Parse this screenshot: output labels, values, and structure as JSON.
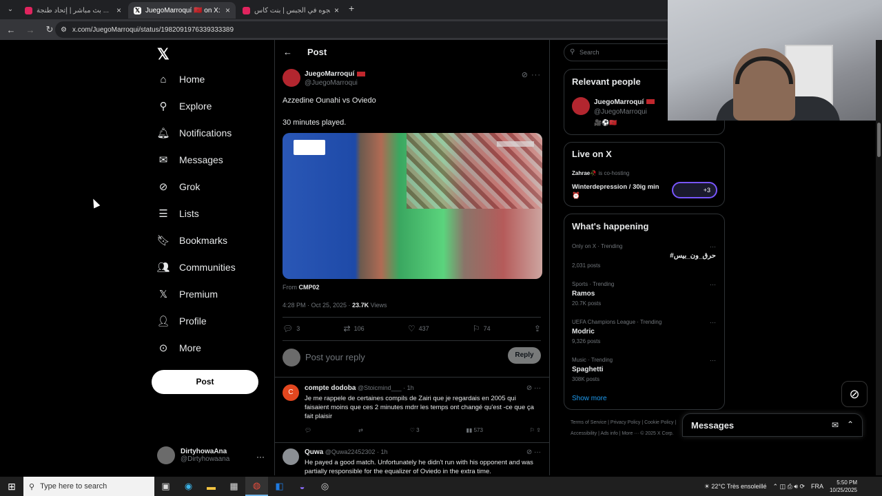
{
  "browser": {
    "tabs": [
      {
        "title": "بث مباشر | إتحاد طنجة ...",
        "active": false
      },
      {
        "title": "JuegoMarroquí 🇲🇦 on X: \"A...",
        "active": true
      },
      {
        "title": "ديدي ديجوه في الجبس | بنت كاس...",
        "active": false
      }
    ],
    "new_tab": "+",
    "url": "x.com/JuegoMarroqui/status/1982091976339333389"
  },
  "leftnav": {
    "items": [
      {
        "label": "Home",
        "icon": "home-icon"
      },
      {
        "label": "Explore",
        "icon": "search-icon"
      },
      {
        "label": "Notifications",
        "icon": "bell-icon"
      },
      {
        "label": "Messages",
        "icon": "mail-icon"
      },
      {
        "label": "Grok",
        "icon": "grok-icon"
      },
      {
        "label": "Lists",
        "icon": "list-icon"
      },
      {
        "label": "Bookmarks",
        "icon": "bookmark-icon"
      },
      {
        "label": "Communities",
        "icon": "people-icon"
      },
      {
        "label": "Premium",
        "icon": "x-icon"
      },
      {
        "label": "Profile",
        "icon": "person-icon"
      },
      {
        "label": "More",
        "icon": "more-circle-icon"
      }
    ],
    "post_button": "Post",
    "account": {
      "name": "DirtyhowaAna",
      "handle": "@Dirtyhowaana"
    }
  },
  "post": {
    "header": "Post",
    "author": "JuegoMarroquí",
    "handle": "@JuegoMarroqui",
    "text1": "Azzedine Ounahi vs Oviedo",
    "text2": "30 minutes played.",
    "from_label": "From",
    "from_source": "CMP02",
    "time": "4:28 PM · Oct 25, 2025 ·",
    "views_count": "23.7K",
    "views_label": "Views",
    "stats": {
      "replies": "3",
      "reposts": "106",
      "likes": "437",
      "bookmarks": "74"
    },
    "reply_placeholder": "Post your reply",
    "reply_button": "Reply"
  },
  "comments": [
    {
      "name": "compte dodoba",
      "handle": "@Stoicmind___ · 1h",
      "text": "Je me rappele de certaines compils de Zairi que je regardais en 2005 qui faisaient moins que ces 2 minutes mdrr les temps ont changé qu'est -ce que ça fait plaisir",
      "likes": "3",
      "views": "573",
      "avatar_letter": "C"
    },
    {
      "name": "Quwa",
      "handle": "@Quwa22452302 · 1h",
      "text": "He payed a good match. Unfortunately he didn't run with his opponent and was partially responsible for the equalizer of Oviedo in the extra time."
    }
  ],
  "sidebar": {
    "search_placeholder": "Search",
    "relevant": {
      "title": "Relevant people",
      "name": "JuegoMarroquí",
      "handle": "@JuegoMarroqui",
      "bio": "🎥⚽🇲🇦"
    },
    "live": {
      "title": "Live on X",
      "host": "Zahrae🥀",
      "hosting_label": "is co-hosting",
      "space_title": "Winterdepression / 30ig min⏰",
      "extra": "+3"
    },
    "happening": {
      "title": "What's happening",
      "trends": [
        {
          "category": "Only on X · Trending",
          "term": "#حرق_ون_بيس",
          "count": "2,031 posts"
        },
        {
          "category": "Sports · Trending",
          "term": "Ramos",
          "count": "20.7K posts"
        },
        {
          "category": "UEFA Champions League · Trending",
          "term": "Modric",
          "count": "9,326 posts"
        },
        {
          "category": "Music · Trending",
          "term": "Spaghetti",
          "count": "308K posts"
        }
      ],
      "show_more": "Show more"
    },
    "footer1": "Terms of Service  |  Privacy Policy  |  Cookie Policy  |",
    "footer2": "Accessibility  |  Ads info  |  More ···  © 2025 X Corp."
  },
  "messages_drawer": {
    "title": "Messages"
  },
  "taskbar": {
    "search_placeholder": "Type here to search",
    "weather": "22°C  Très ensoleillé",
    "lang": "FRA",
    "time": "5:50 PM",
    "date": "10/25/2025"
  },
  "colors": {
    "accent": "#1d9bf0",
    "background": "#000000",
    "border": "#2f3336",
    "muted": "#71767b"
  }
}
